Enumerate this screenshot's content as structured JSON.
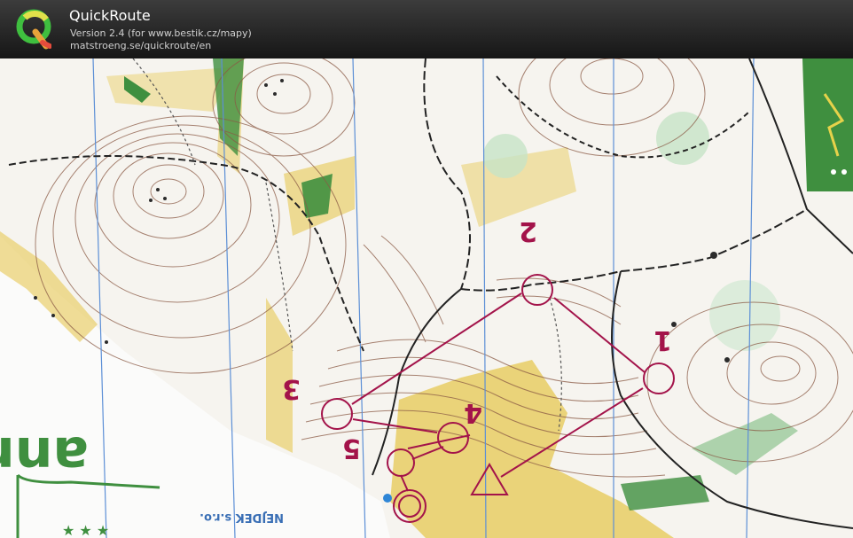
{
  "app": {
    "title": "QuickRoute",
    "version_line": "Version 2.4  (for www.bestik.cz/mapy)",
    "url_line": "matstroeng.se/quickroute/en",
    "logo_letter": "Q"
  },
  "map": {
    "control_labels": [
      "1",
      "2",
      "3",
      "4",
      "5"
    ],
    "brand_text": "anna",
    "maker_text": "NEJDEK s.r.o.",
    "stars": "★ ★ ★",
    "colors": {
      "course": "#a3134a",
      "yellow": "#e9cf6b",
      "green": "#3f8f3f",
      "contour": "#8a5a45",
      "blue_line": "#5c8fd6"
    }
  }
}
